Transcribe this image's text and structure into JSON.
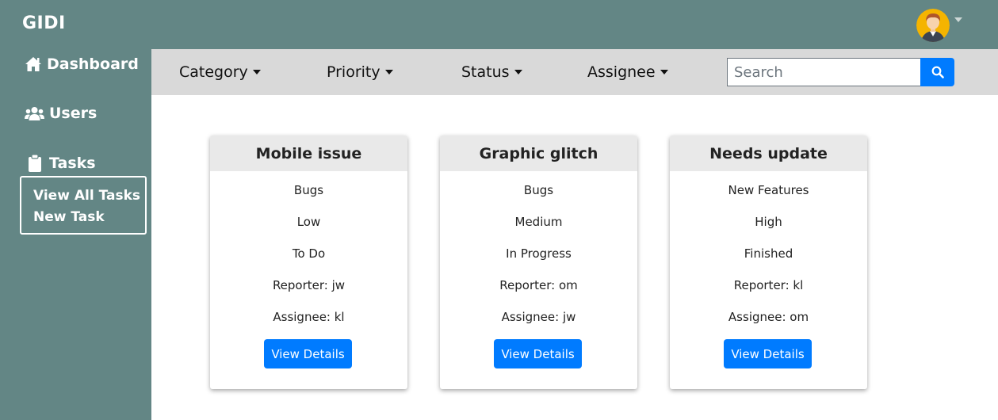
{
  "app": {
    "brand": "GIDI"
  },
  "sidebar": {
    "items": [
      {
        "label": "Dashboard",
        "icon": "home-icon"
      },
      {
        "label": "Users",
        "icon": "users-icon"
      },
      {
        "label": "Tasks",
        "icon": "clipboard-icon"
      }
    ],
    "tasks_submenu": [
      "View All Tasks",
      "New Task"
    ]
  },
  "filters": {
    "items": [
      {
        "label": "Category"
      },
      {
        "label": "Priority"
      },
      {
        "label": "Status"
      },
      {
        "label": "Assignee"
      }
    ],
    "search_placeholder": "Search",
    "search_icon": "search-icon"
  },
  "colors": {
    "sidebar_bg": "#638685",
    "filterbar_bg": "#d9d9d9",
    "accent": "#007bff"
  },
  "cards": [
    {
      "title": "Mobile issue",
      "category": "Bugs",
      "priority": "Low",
      "status": "To Do",
      "reporter": "Reporter: jw",
      "assignee": "Assignee: kl",
      "button": "View Details"
    },
    {
      "title": "Graphic glitch",
      "category": "Bugs",
      "priority": "Medium",
      "status": "In Progress",
      "reporter": "Reporter: om",
      "assignee": "Assignee: jw",
      "button": "View Details"
    },
    {
      "title": "Needs update",
      "category": "New Features",
      "priority": "High",
      "status": "Finished",
      "reporter": "Reporter: kl",
      "assignee": "Assignee: om",
      "button": "View Details"
    }
  ]
}
